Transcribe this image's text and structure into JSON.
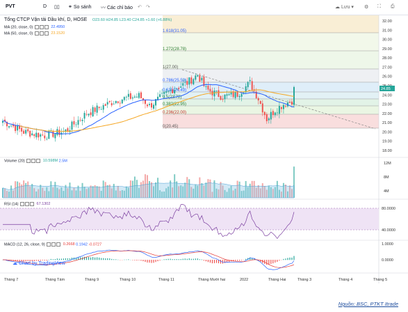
{
  "toolbar": {
    "symbol": "PVT",
    "interval": "D",
    "compare_label": "So sánh",
    "indicators_label": "Các chỉ báo",
    "save_label": "Lưu"
  },
  "main_legend": {
    "title": "Tổng CTCP Vận tải Dầu khí, D, HOSE",
    "open": "O23.60",
    "high": "H24.85",
    "low": "L23.40",
    "close": "C24.85",
    "change": "+1.60 (+6.88%)",
    "ma20_label": "MA (20, close, 0)",
    "ma20_value": "22.4950",
    "ma50_label": "MA (50, close, 0)",
    "ma50_value": "23.1520"
  },
  "fib_labels": [
    {
      "label": "1.618(31.05)"
    },
    {
      "label": "1.272(28.78)"
    },
    {
      "label": "1(27.00)"
    },
    {
      "label": "0.786(25.59)"
    },
    {
      "label": "0.618(24.49)"
    },
    {
      "label": "0.5(23.72)"
    },
    {
      "label": "0.382(22.95)"
    },
    {
      "label": "0.236(22.00)"
    },
    {
      "label": "0(20.45)"
    }
  ],
  "price_axis": [
    "32.00",
    "31.00",
    "30.00",
    "29.00",
    "28.00",
    "27.00",
    "26.00",
    "25.00",
    "24.00",
    "23.00",
    "22.00",
    "21.00",
    "20.00",
    "19.00",
    "18.00"
  ],
  "last_price": "24.85",
  "volume": {
    "label": "Volume (20)",
    "value1": "10.598M",
    "value2": "2.5M",
    "axis": [
      "12M",
      "8M",
      "4M"
    ]
  },
  "rsi": {
    "label": "RSI (14)",
    "value": "67.1302",
    "axis": [
      "80.0000",
      "40.0000"
    ]
  },
  "macd": {
    "label": "MACD (12, 26, close, 9)",
    "v1": "0.2668",
    "v2": "0.1942",
    "v3": "-0.0727",
    "axis": [
      "1.0000",
      "0.0000"
    ]
  },
  "watermark": "Chart by TradingView",
  "time_axis": [
    "Tháng 7",
    "Tháng Tám",
    "Tháng 9",
    "Tháng 10",
    "Tháng 11",
    "Tháng Mười hai",
    "2022",
    "Tháng Hai",
    "Tháng 3",
    "Tháng 4",
    "Tháng 5"
  ],
  "source": "Nguồn: BSC, PTKT Itrade"
}
